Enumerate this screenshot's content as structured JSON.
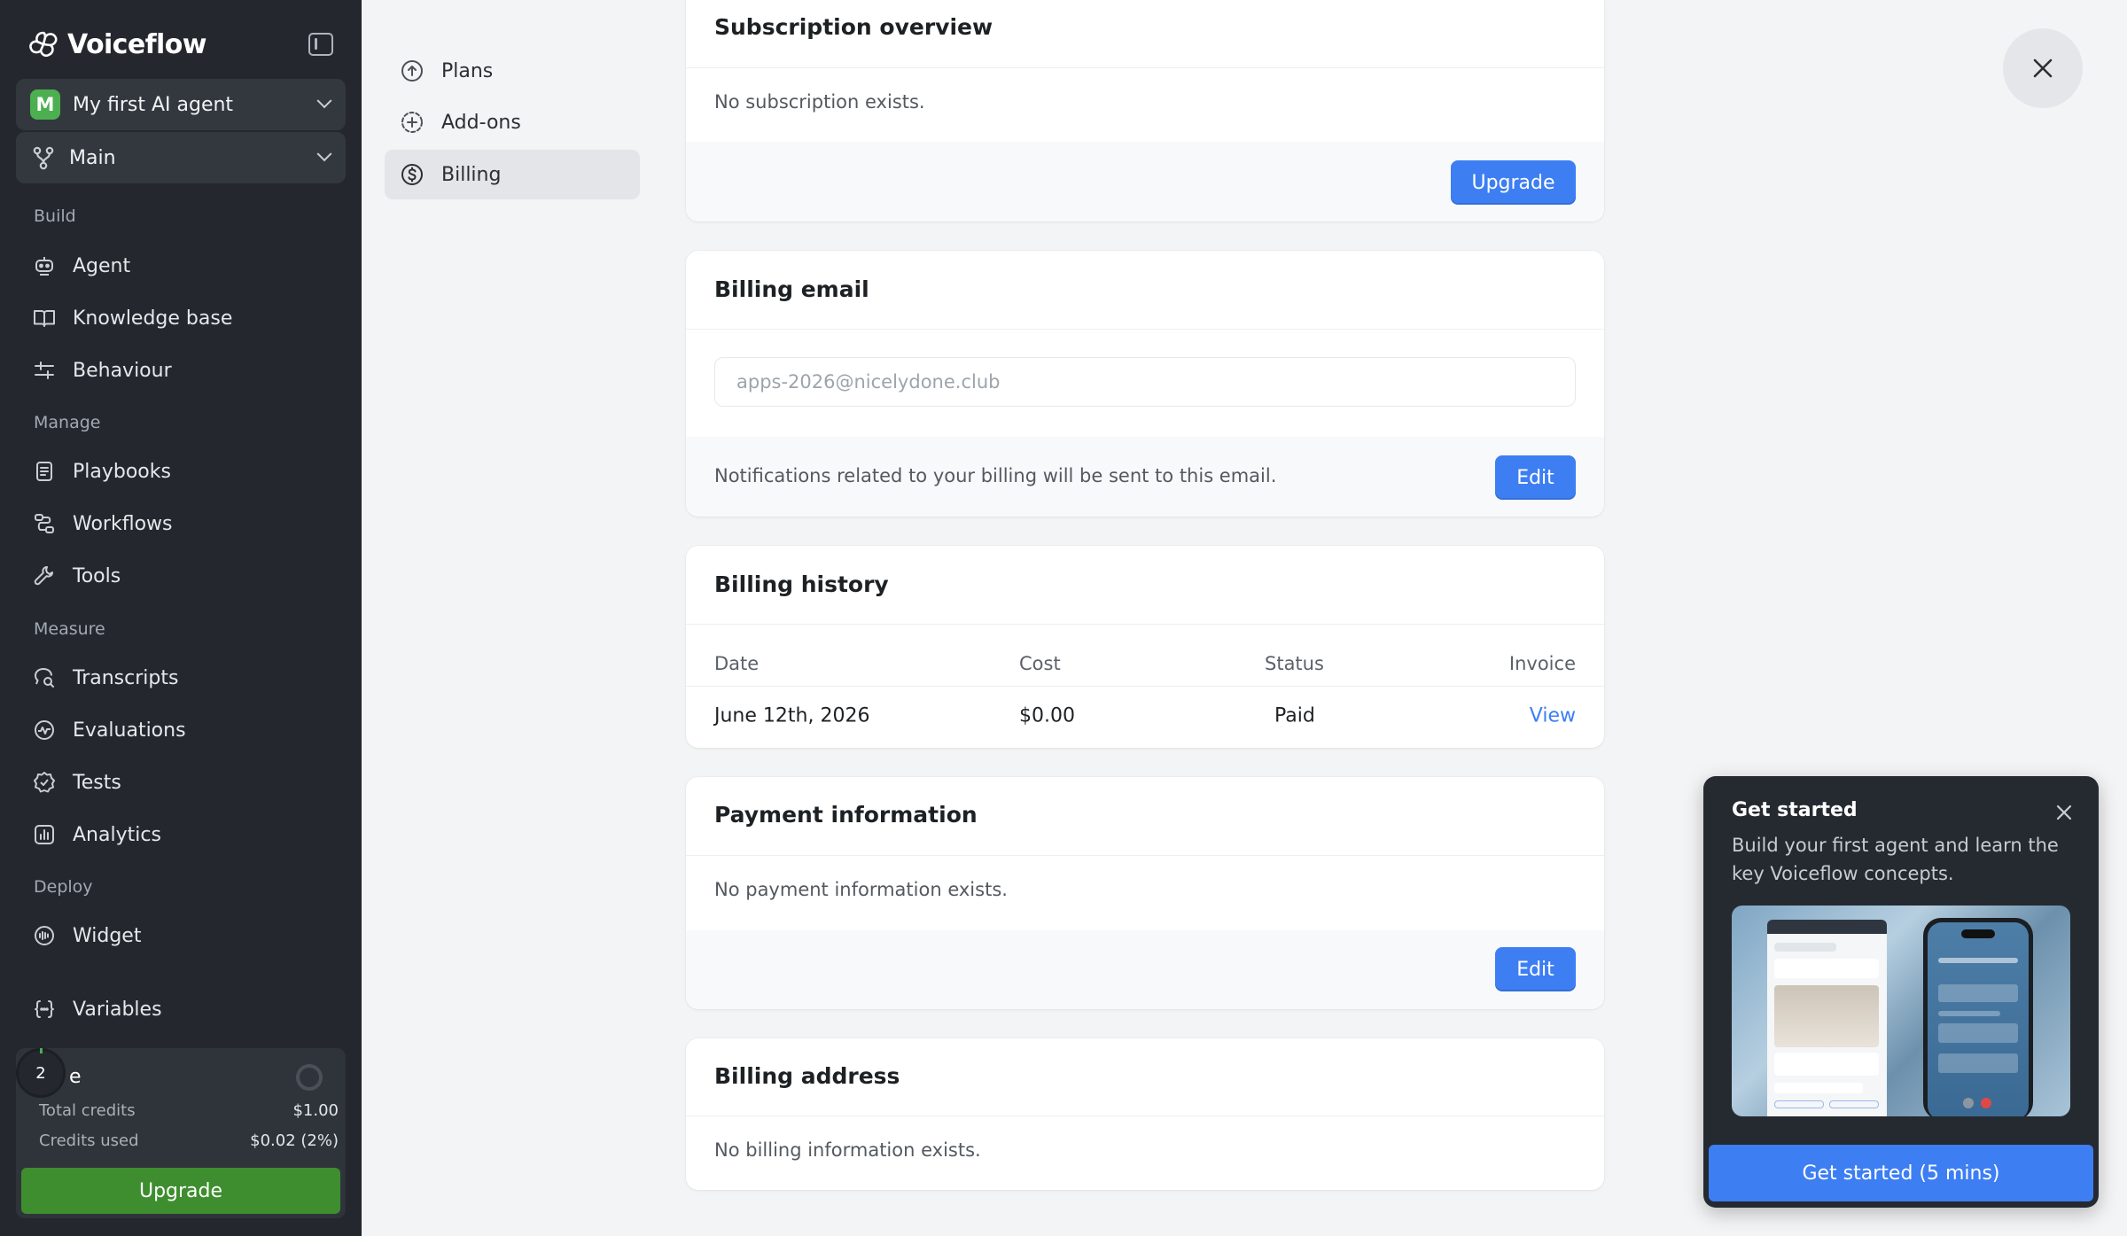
{
  "sidebar": {
    "brand": "Voiceflow",
    "agent": {
      "initial": "M",
      "name": "My first AI agent"
    },
    "branch": {
      "name": "Main"
    },
    "sections": {
      "build": "Build",
      "manage": "Manage",
      "measure": "Measure",
      "deploy": "Deploy"
    },
    "items": {
      "agent": "Agent",
      "knowledge_base": "Knowledge base",
      "behaviour": "Behaviour",
      "playbooks": "Playbooks",
      "workflows": "Workflows",
      "tools": "Tools",
      "transcripts": "Transcripts",
      "evaluations": "Evaluations",
      "tests": "Tests",
      "analytics": "Analytics",
      "widget": "Widget",
      "variables": "Variables"
    },
    "credits": {
      "ring_value": "2",
      "plan_name": "e",
      "total_label": "Total credits",
      "total_value": "$1.00",
      "used_label": "Credits used",
      "used_value": "$0.02 (2%)",
      "upgrade_label": "Upgrade"
    }
  },
  "subnav": {
    "plans": "Plans",
    "addons": "Add-ons",
    "billing": "Billing"
  },
  "subscription": {
    "title": "Subscription overview",
    "message": "No subscription exists.",
    "upgrade_label": "Upgrade"
  },
  "billing_email": {
    "title": "Billing email",
    "placeholder": "apps-2026@nicelydone.club",
    "note": "Notifications related to your billing will be sent to this email.",
    "edit_label": "Edit"
  },
  "billing_history": {
    "title": "Billing history",
    "columns": {
      "date": "Date",
      "cost": "Cost",
      "status": "Status",
      "invoice": "Invoice"
    },
    "rows": [
      {
        "date": "June 12th, 2026",
        "cost": "$0.00",
        "status": "Paid",
        "invoice": "View"
      }
    ]
  },
  "payment": {
    "title": "Payment information",
    "message": "No payment information exists.",
    "edit_label": "Edit"
  },
  "billing_address": {
    "title": "Billing address",
    "message": "No billing information exists."
  },
  "get_started": {
    "title": "Get started",
    "description": "Build your first agent and learn the key Voiceflow concepts.",
    "button_label": "Get started (5 mins)"
  },
  "colors": {
    "sidebar_bg": "#24282e",
    "accent_blue": "#3d7ef3",
    "upgrade_green": "#3e8e2f",
    "agent_badge": "#4caf50"
  }
}
